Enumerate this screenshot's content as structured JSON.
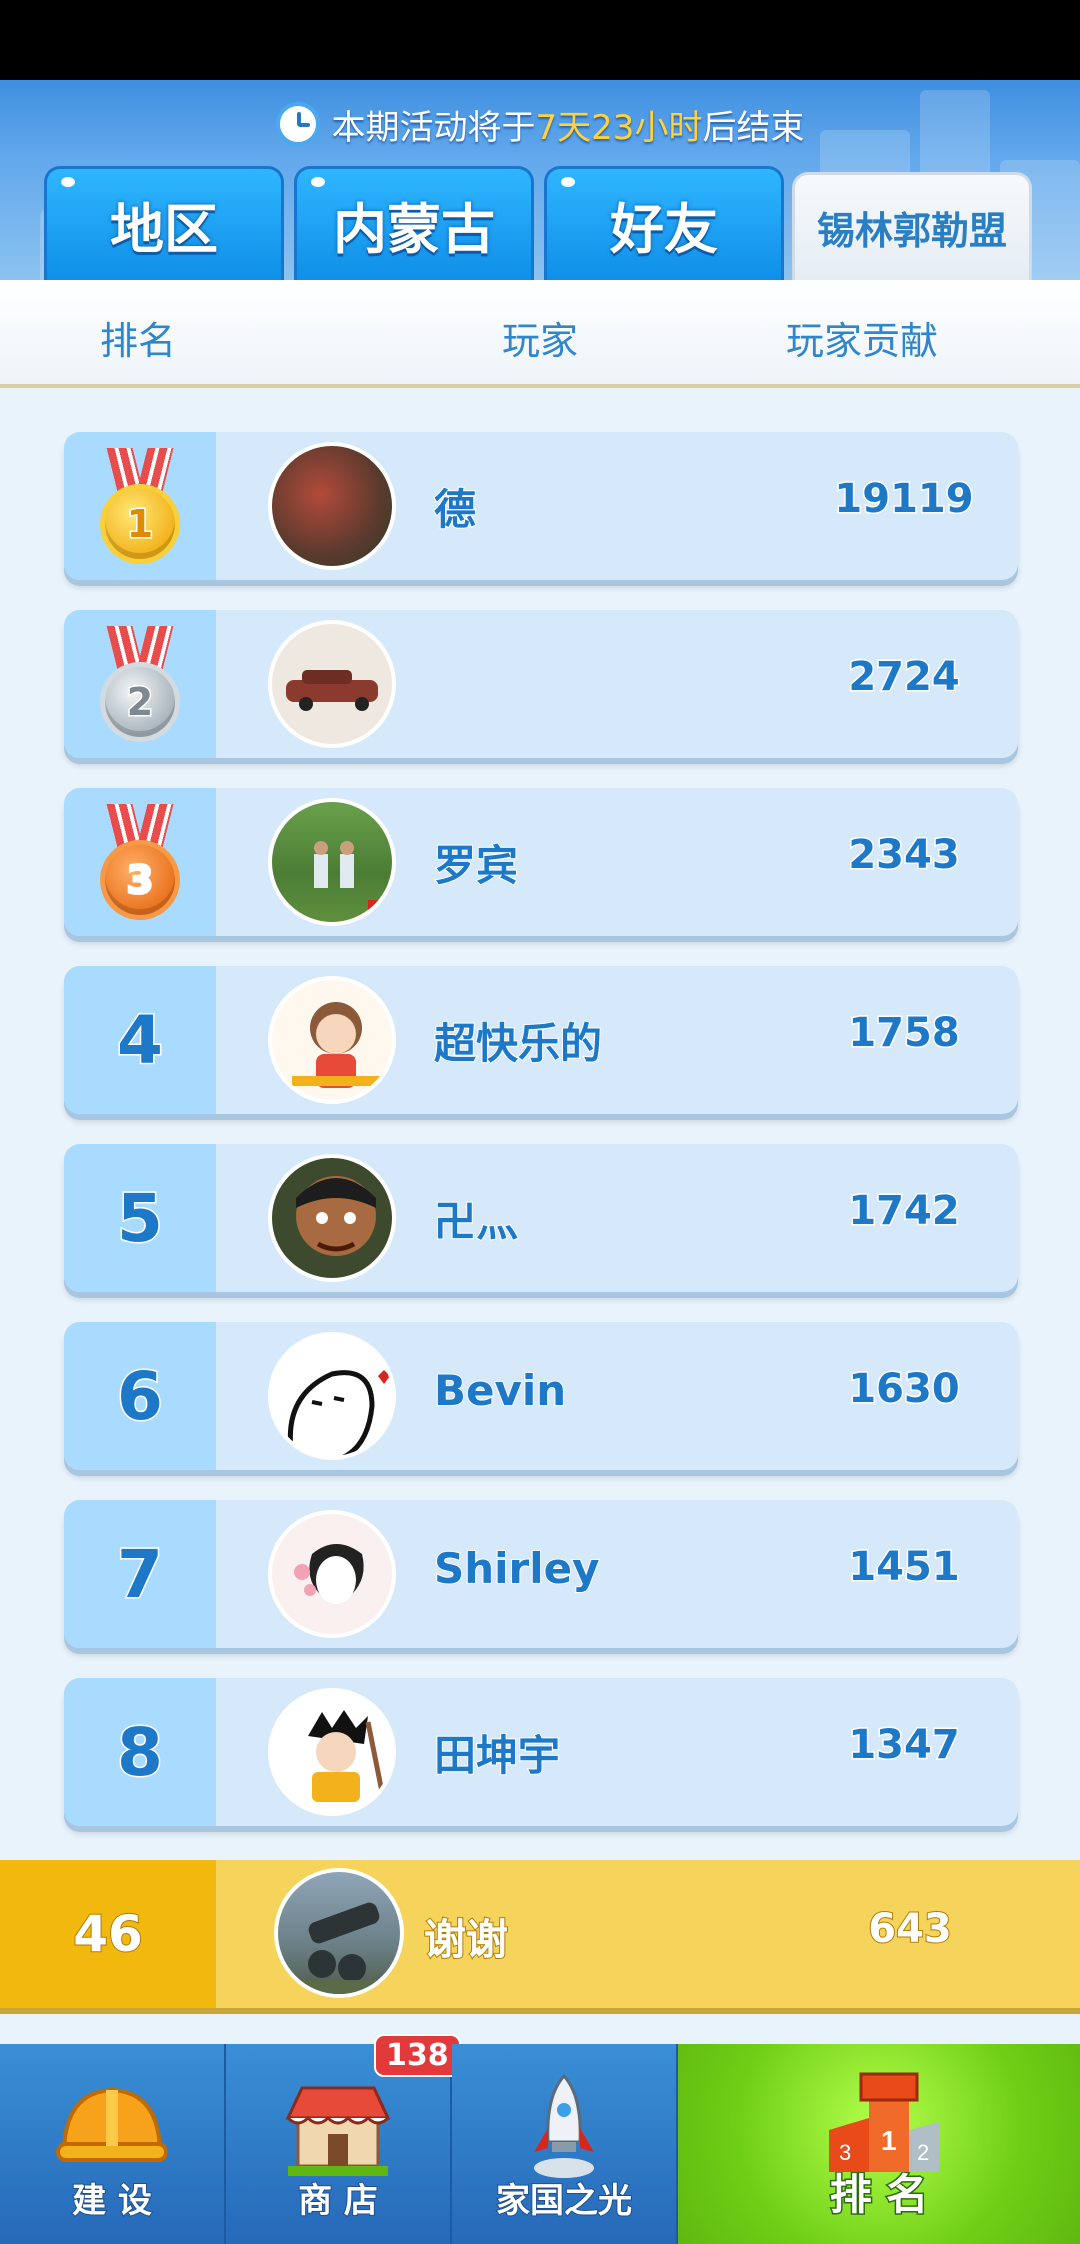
{
  "header": {
    "timer_prefix": "本期活动将于",
    "timer_highlight": "7天23小时",
    "timer_suffix": "后结束"
  },
  "tabs": [
    {
      "label": "地区",
      "active": false
    },
    {
      "label": "内蒙古",
      "active": false
    },
    {
      "label": "好友",
      "active": false
    },
    {
      "label": "锡林郭勒盟",
      "active": true
    }
  ],
  "columns": {
    "rank": "排名",
    "player": "玩家",
    "contribution": "玩家贡献"
  },
  "rows": [
    {
      "rank": "1",
      "name": "德",
      "score": "19119",
      "medal": "gold"
    },
    {
      "rank": "2",
      "name": "",
      "score": "2724",
      "medal": "silver"
    },
    {
      "rank": "3",
      "name": "罗宾",
      "score": "2343",
      "medal": "bronze"
    },
    {
      "rank": "4",
      "name": "超快乐的",
      "score": "1758"
    },
    {
      "rank": "5",
      "name": "卍灬",
      "score": "1742"
    },
    {
      "rank": "6",
      "name": "Bevin",
      "score": "1630"
    },
    {
      "rank": "7",
      "name": "Shirley",
      "score": "1451"
    },
    {
      "rank": "8",
      "name": "田坤宇",
      "score": "1347"
    }
  ],
  "me": {
    "rank": "46",
    "name": "谢谢",
    "score": "643"
  },
  "nav": [
    {
      "label": "建 设",
      "icon": "helmet-icon"
    },
    {
      "label": "商 店",
      "icon": "shop-icon",
      "badge": "138"
    },
    {
      "label": "家国之光",
      "icon": "rocket-icon"
    },
    {
      "label": "排 名",
      "icon": "podium-icon",
      "active": true
    }
  ],
  "colors": {
    "accent": "#1e78c8",
    "tab_blue": "#1ea3f5",
    "me_row": "#f6d35a",
    "nav_active": "#7ed321"
  }
}
